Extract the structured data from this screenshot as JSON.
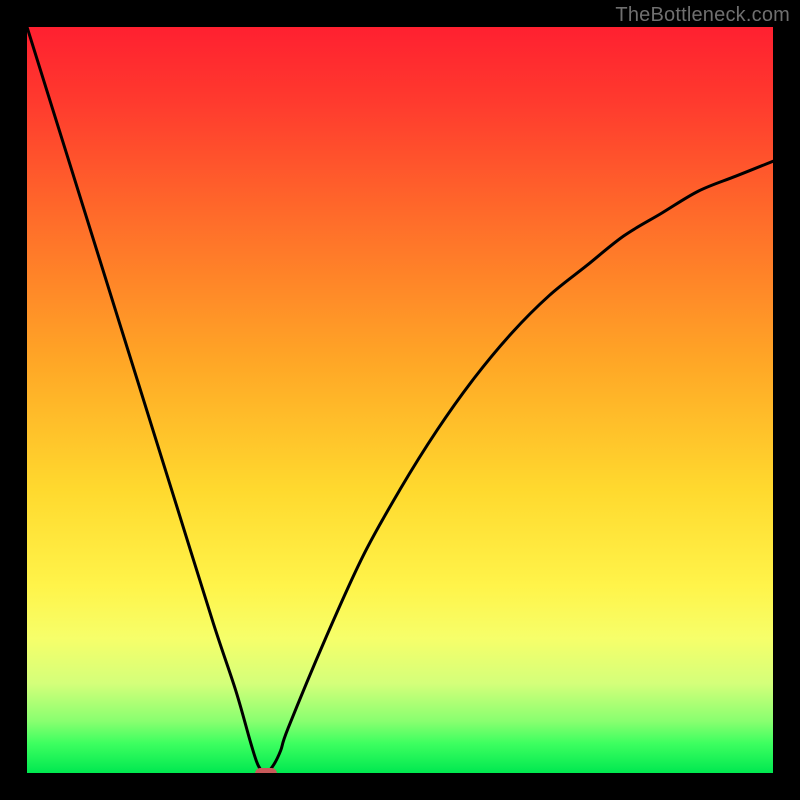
{
  "watermark": "TheBottleneck.com",
  "colors": {
    "frame": "#000000",
    "curve": "#000000",
    "marker": "#c85a5a",
    "gradient_top": "#ff2030",
    "gradient_bottom": "#00e850"
  },
  "chart_data": {
    "type": "line",
    "title": "",
    "xlabel": "",
    "ylabel": "",
    "xlim": [
      0,
      100
    ],
    "ylim": [
      0,
      100
    ],
    "grid": false,
    "legend": false,
    "annotations": [],
    "x": [
      0,
      5,
      10,
      15,
      20,
      25,
      28,
      30,
      31,
      32,
      33,
      34,
      35,
      40,
      45,
      50,
      55,
      60,
      65,
      70,
      75,
      80,
      85,
      90,
      95,
      100
    ],
    "values": [
      100,
      84,
      68,
      52,
      36,
      20,
      11,
      4,
      1,
      0,
      1,
      3,
      6,
      18,
      29,
      38,
      46,
      53,
      59,
      64,
      68,
      72,
      75,
      78,
      80,
      82
    ],
    "marker": {
      "x": 32,
      "y": 0,
      "shape": "rounded-rect"
    }
  }
}
